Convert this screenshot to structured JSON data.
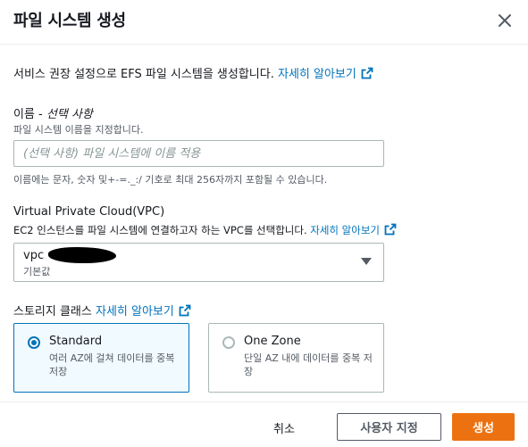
{
  "modal": {
    "title": "파일 시스템 생성"
  },
  "intro": {
    "text": "서비스 권장 설정으로 EFS 파일 시스템을 생성합니다.",
    "learn_more": "자세히 알아보기"
  },
  "name_field": {
    "label": "이름",
    "label_suffix": " - ",
    "optional": "선택 사항",
    "description": "파일 시스템 이름을 지정합니다.",
    "placeholder": "(선택 사항) 파일 시스템에 이름 적용",
    "value": "",
    "constraint": "이름에는 문자, 숫자 및+-=._:/ 기호로 최대 256자까지 포함될 수 있습니다."
  },
  "vpc_field": {
    "label": "Virtual Private Cloud(VPC)",
    "description": "EC2 인스턴스를 파일 시스템에 연결하고자 하는 VPC를 선택합니다.",
    "learn_more": "자세히 알아보기",
    "selected_value": "vpc",
    "selected_sub": "기본값"
  },
  "storage_class": {
    "label": "스토리지 클래스",
    "learn_more": "자세히 알아보기",
    "options": [
      {
        "title": "Standard",
        "description": "여러 AZ에 걸쳐 데이터를 중복 저장",
        "selected": true
      },
      {
        "title": "One Zone",
        "description": "단일 AZ 내에 데이터를 중복 저장",
        "selected": false
      }
    ]
  },
  "footer": {
    "cancel": "취소",
    "customize": "사용자 지정",
    "create": "생성"
  },
  "colors": {
    "link": "#0073bb",
    "primary": "#ec7211",
    "selected_bg": "#f1faff",
    "border": "#aab7b8"
  },
  "icons": [
    "close-icon",
    "external-link-icon",
    "caret-down-icon",
    "radio-checked-icon",
    "radio-unchecked-icon"
  ]
}
